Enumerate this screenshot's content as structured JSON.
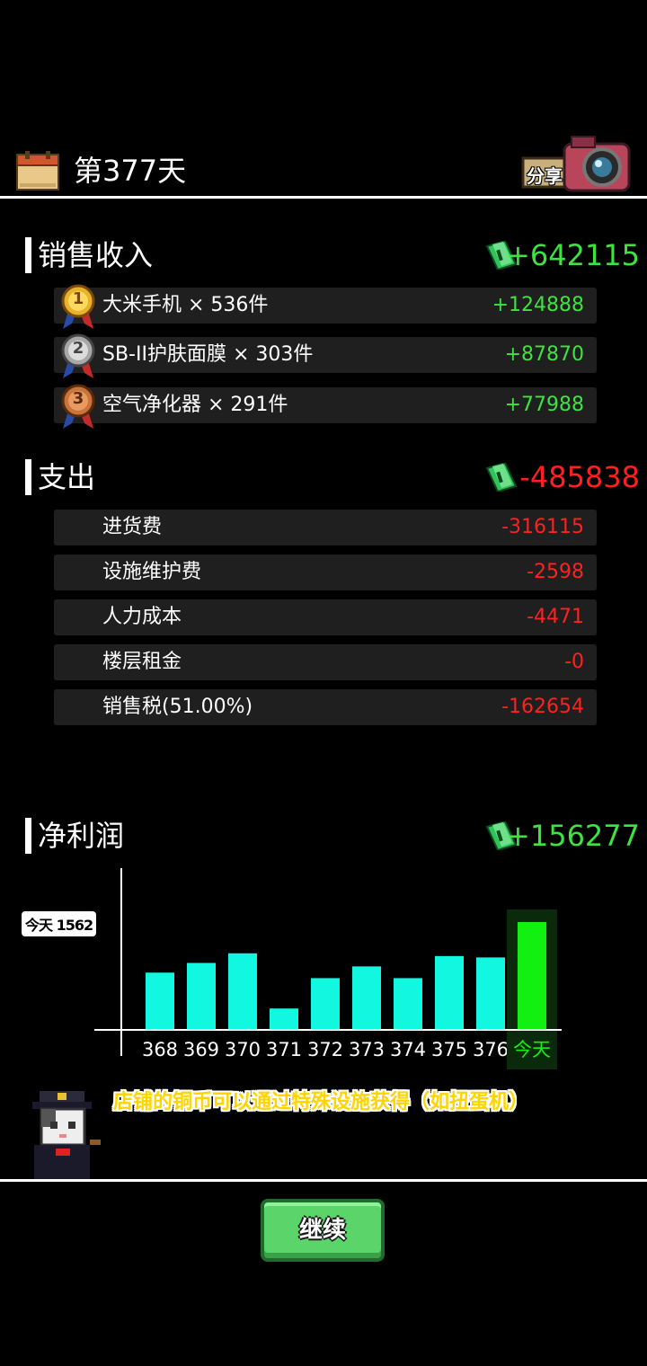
{
  "header": {
    "day_title": "第377天",
    "share_label": "分享"
  },
  "sales": {
    "title": "销售收入",
    "total": "+642115",
    "items": [
      {
        "rank": "1",
        "label": "大米手机 × 536件",
        "value": "+124888"
      },
      {
        "rank": "2",
        "label": "SB-II护肤面膜 × 303件",
        "value": "+87870"
      },
      {
        "rank": "3",
        "label": "空气净化器 × 291件",
        "value": "+77988"
      }
    ]
  },
  "expenses": {
    "title": "支出",
    "total": "-485838",
    "items": [
      {
        "label": "进货费",
        "value": "-316115"
      },
      {
        "label": "设施维护费",
        "value": "-2598"
      },
      {
        "label": "人力成本",
        "value": "-4471"
      },
      {
        "label": "楼层租金",
        "value": "-0"
      },
      {
        "label": "销售税(51.00%)",
        "value": "-162654"
      }
    ]
  },
  "profit": {
    "title": "净利润",
    "total": "+156277"
  },
  "chart_data": {
    "type": "bar",
    "categories": [
      "368",
      "369",
      "370",
      "371",
      "372",
      "373",
      "374",
      "375",
      "376",
      "今天"
    ],
    "values": [
      83000,
      97000,
      111000,
      31000,
      75000,
      92000,
      75000,
      107000,
      105000,
      156277
    ],
    "highlight_label": "今天 1562",
    "colors": {
      "bar": "#11f7e0",
      "today": "#11f011",
      "today_bg": "#0b2a0b"
    }
  },
  "tip": {
    "text": "店铺的铜币可以通过特殊设施获得（如扭蛋机）"
  },
  "continue_label": "继续",
  "colors": {
    "income": "#3fe33f",
    "expense": "#ff2020"
  }
}
